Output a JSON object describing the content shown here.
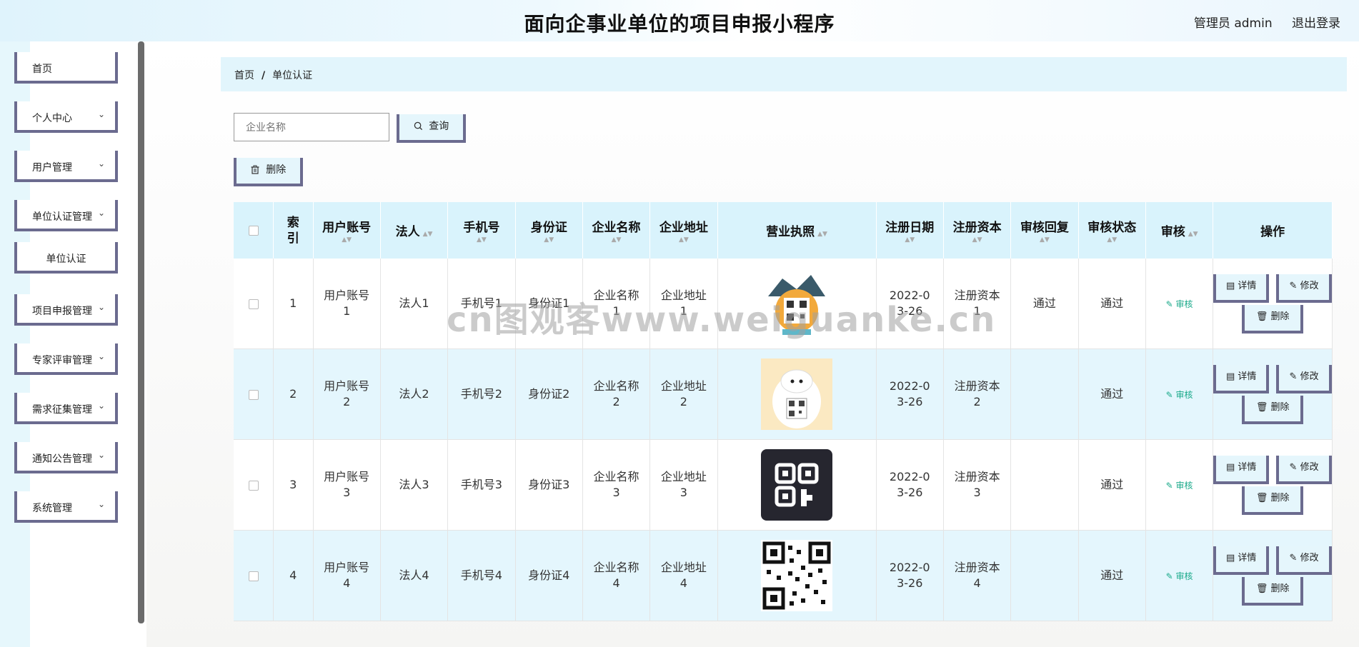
{
  "header": {
    "title": "面向企事业单位的项目申报小程序",
    "admin_label": "管理员 admin",
    "logout": "退出登录"
  },
  "sidebar": {
    "items": [
      {
        "label": "首页",
        "has_children": false
      },
      {
        "label": "个人中心",
        "has_children": true
      },
      {
        "label": "用户管理",
        "has_children": true
      },
      {
        "label": "单位认证管理",
        "has_children": true
      },
      {
        "label": "单位认证",
        "sub": true
      },
      {
        "label": "项目申报管理",
        "has_children": true
      },
      {
        "label": "专家评审管理",
        "has_children": true
      },
      {
        "label": "需求征集管理",
        "has_children": true
      },
      {
        "label": "通知公告管理",
        "has_children": true
      },
      {
        "label": "系统管理",
        "has_children": true
      }
    ],
    "chevron": "⌄"
  },
  "breadcrumb": {
    "home": "首页",
    "separator": "/",
    "current": "单位认证"
  },
  "search": {
    "placeholder": "企业名称",
    "button": "查询"
  },
  "toolbar": {
    "delete": "删除"
  },
  "table": {
    "headers": [
      "索引",
      "用户账号",
      "法人",
      "手机号",
      "身份证",
      "企业名称",
      "企业地址",
      "营业执照",
      "注册日期",
      "注册资本",
      "审核回复",
      "审核状态",
      "审核",
      "操作"
    ],
    "rows": [
      {
        "index": "1",
        "account": "用户账号1",
        "legal": "法人1",
        "phone": "手机号1",
        "idcard": "身份证1",
        "company": "企业名称1",
        "address": "企业地址1",
        "date": "2022-03-26",
        "capital": "注册资本1",
        "reply": "通过",
        "status": "通过",
        "audit": "审核"
      },
      {
        "index": "2",
        "account": "用户账号2",
        "legal": "法人2",
        "phone": "手机号2",
        "idcard": "身份证2",
        "company": "企业名称2",
        "address": "企业地址2",
        "date": "2022-03-26",
        "capital": "注册资本2",
        "reply": "",
        "status": "通过",
        "audit": "审核"
      },
      {
        "index": "3",
        "account": "用户账号3",
        "legal": "法人3",
        "phone": "手机号3",
        "idcard": "身份证3",
        "company": "企业名称3",
        "address": "企业地址3",
        "date": "2022-03-26",
        "capital": "注册资本3",
        "reply": "",
        "status": "通过",
        "audit": "审核"
      },
      {
        "index": "4",
        "account": "用户账号4",
        "legal": "法人4",
        "phone": "手机号4",
        "idcard": "身份证4",
        "company": "企业名称4",
        "address": "企业地址4",
        "date": "2022-03-26",
        "capital": "注册资本4",
        "reply": "",
        "status": "通过",
        "audit": "审核"
      }
    ],
    "actions": {
      "detail": "详情",
      "edit": "修改",
      "delete": "删除"
    }
  },
  "watermark": "cn图观客www.weiguanke.cn",
  "colors": {
    "accent_border": "#6b6b8f",
    "header_row": "#d9f3fc",
    "striped_row": "#e4f6fd",
    "audit_green": "#1aa98a"
  }
}
